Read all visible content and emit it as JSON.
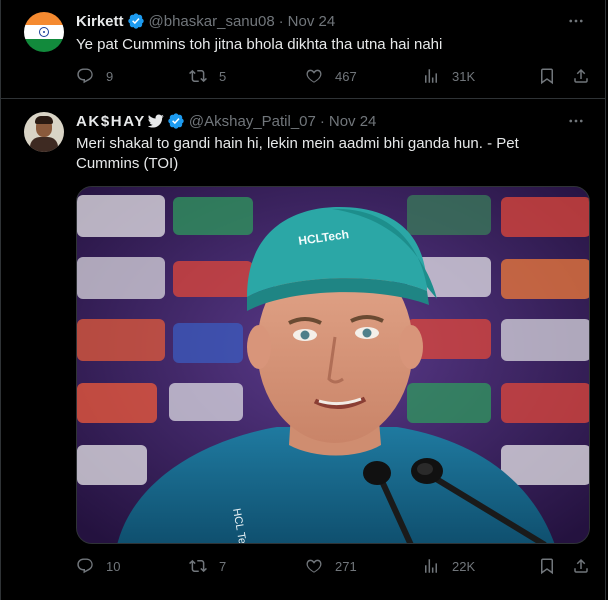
{
  "tweets": [
    {
      "display_name": "Kirkett",
      "handle": "@bhaskar_sanu08",
      "date": "Nov 24",
      "avatar_icon": "india-flag-avatar",
      "text": "Ye pat Cummins toh jitna bhola dikhta tha utna hai nahi",
      "replies": "9",
      "reposts": "5",
      "likes": "467",
      "views": "31K"
    },
    {
      "display_name": "AK$HAY",
      "handle": "@Akshay_Patil_07",
      "date": "Nov 24",
      "avatar_icon": "man-portrait-avatar",
      "text": "Meri shakal to gandi hain hi, lekin mein aadmi bhi ganda hun. - Pet Cummins (TOI)",
      "media_caption_cap": "HCLTech",
      "media_shirt_text": "HCL Tech",
      "replies": "10",
      "reposts": "7",
      "likes": "271",
      "views": "22K"
    }
  ],
  "colors": {
    "background": "#000000",
    "text_primary": "#e7e9ea",
    "text_secondary": "#71767b",
    "verified_blue": "#1d9bf0",
    "divider": "#2f3336"
  }
}
